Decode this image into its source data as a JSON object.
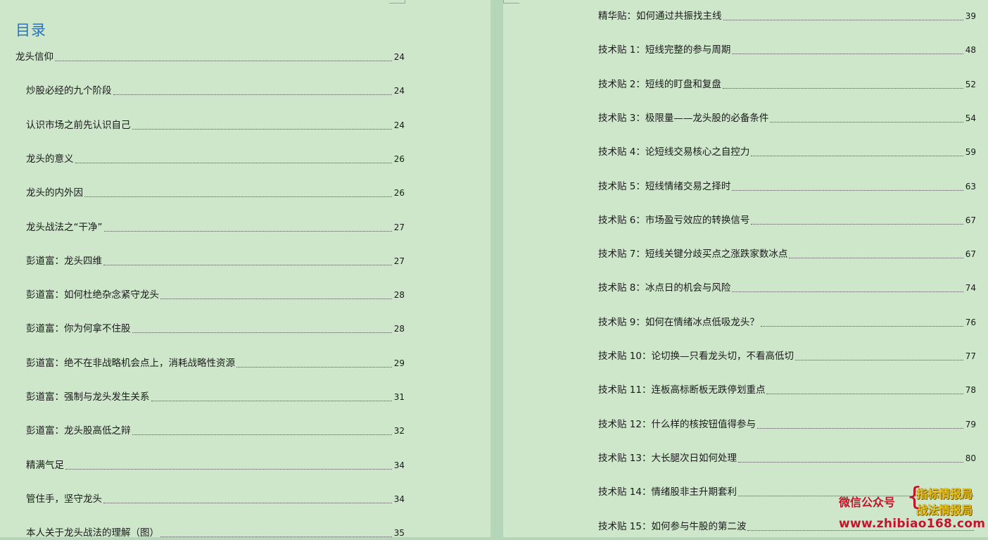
{
  "toc_title": "目录",
  "left_entries": [
    {
      "text": "龙头信仰",
      "page": "24",
      "level": 1
    },
    {
      "text": "炒股必经的九个阶段",
      "page": "24",
      "level": 2
    },
    {
      "text": "认识市场之前先认识自己",
      "page": "24",
      "level": 2
    },
    {
      "text": "龙头的意义",
      "page": "26",
      "level": 2
    },
    {
      "text": "龙头的内外因",
      "page": "26",
      "level": 2
    },
    {
      "text": "龙头战法之“干净”",
      "page": "27",
      "level": 2
    },
    {
      "text": "彭道富：龙头四维",
      "page": "27",
      "level": 2
    },
    {
      "text": "彭道富：如何杜绝杂念紧守龙头",
      "page": "28",
      "level": 2
    },
    {
      "text": "彭道富：你为何拿不住股",
      "page": "28",
      "level": 2
    },
    {
      "text": "彭道富：绝不在非战略机会点上，消耗战略性资源",
      "page": "29",
      "level": 2
    },
    {
      "text": "彭道富：强制与龙头发生关系",
      "page": "31",
      "level": 2
    },
    {
      "text": "彭道富：龙头股高低之辩",
      "page": "32",
      "level": 2
    },
    {
      "text": "精满气足",
      "page": "34",
      "level": 2
    },
    {
      "text": "管住手，坚守龙头",
      "page": "34",
      "level": 2
    },
    {
      "text": "本人关于龙头战法的理解（图）",
      "page": "35",
      "level": 2
    }
  ],
  "right_entries": [
    {
      "text": "精华贴：如何通过共振找主线",
      "page": "39"
    },
    {
      "text": "技术贴 1：短线完整的参与周期",
      "page": "48"
    },
    {
      "text": "技术贴 2：短线的盯盘和复盘",
      "page": "52"
    },
    {
      "text": "技术贴 3：极限量——龙头股的必备条件",
      "page": "54"
    },
    {
      "text": "技术贴 4：论短线交易核心之自控力",
      "page": "59"
    },
    {
      "text": "技术贴 5：短线情绪交易之择时",
      "page": "63"
    },
    {
      "text": "技术贴 6：市场盈亏效应的转换信号",
      "page": "67"
    },
    {
      "text": "技术贴 7：短线关键分歧买点之涨跌家数冰点",
      "page": "67"
    },
    {
      "text": "技术贴 8：冰点日的机会与风险",
      "page": "74"
    },
    {
      "text": "技术贴 9：如何在情绪冰点低吸龙头？",
      "page": "76"
    },
    {
      "text": "技术贴 10：论切换—只看龙头切，不看高低切",
      "page": "77"
    },
    {
      "text": "技术贴 11：连板高标断板无跌停划重点",
      "page": "78"
    },
    {
      "text": "技术贴 12：什么样的核按钮值得参与",
      "page": "79"
    },
    {
      "text": "技术贴 13：大长腿次日如何处理",
      "page": "80"
    },
    {
      "text": "技术贴 14：情绪股非主升期套利",
      "page": ""
    },
    {
      "text": "技术贴 15：如何参与牛股的第二波",
      "page": ""
    }
  ],
  "watermark": {
    "label": "微信公众号",
    "brace": "{",
    "line1": "指标情报局",
    "line2": "战法情报局",
    "url": "www.zhibiao168.com"
  }
}
